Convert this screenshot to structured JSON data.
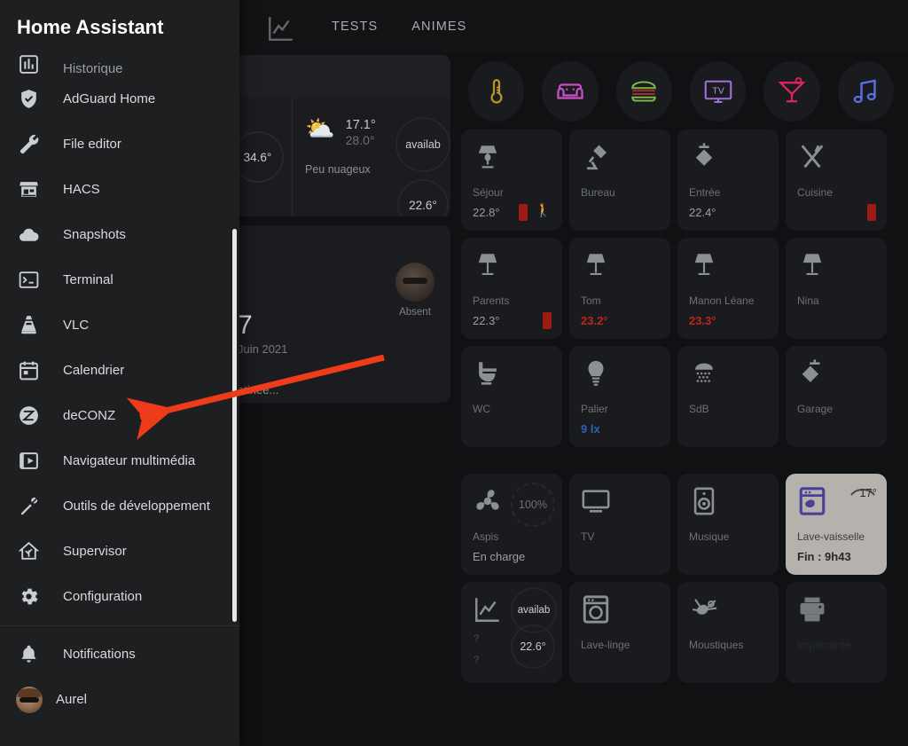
{
  "app": {
    "title": "Home Assistant"
  },
  "topbar": {
    "tabs": [
      {
        "label": "",
        "icon": "chart-line-icon"
      },
      {
        "label": "TESTS",
        "icon": ""
      },
      {
        "label": "ANIMES",
        "icon": ""
      }
    ]
  },
  "sidebar": {
    "title": "Home Assistant",
    "items": [
      {
        "label": "Historique",
        "icon": "chart-box-icon"
      },
      {
        "label": "AdGuard Home",
        "icon": "shield-check-icon"
      },
      {
        "label": "File editor",
        "icon": "wrench-icon"
      },
      {
        "label": "HACS",
        "icon": "store-icon"
      },
      {
        "label": "Snapshots",
        "icon": "cloud-icon"
      },
      {
        "label": "Terminal",
        "icon": "console-icon"
      },
      {
        "label": "VLC",
        "icon": "vlc-cone-icon"
      },
      {
        "label": "Calendrier",
        "icon": "calendar-icon"
      },
      {
        "label": "deCONZ",
        "icon": "zigbee-icon"
      },
      {
        "label": "Navigateur multimédia",
        "icon": "media-player-icon"
      },
      {
        "label": "Outils de développement",
        "icon": "hammer-wrench-icon"
      },
      {
        "label": "Supervisor",
        "icon": "home-assistant-icon"
      },
      {
        "label": "Configuration",
        "icon": "gear-icon"
      }
    ],
    "bottom": [
      {
        "label": "Notifications",
        "icon": "bell-icon"
      },
      {
        "label": "Aurel",
        "icon": "user-avatar"
      }
    ]
  },
  "weather": {
    "left_value": "34.6°",
    "icon": "partly-cloudy-icon",
    "temp_high": "17.1°",
    "temp_low": "28.0°",
    "condition": "Peu nuageux",
    "availability": "availab",
    "temp_right": "22.6°"
  },
  "person": {
    "state": "Absent",
    "big": "7",
    "date": "Juin 2021",
    "note": "atinée..."
  },
  "scenes": [
    {
      "name": "thermometer-scene",
      "icon": "thermometer-icon",
      "color": "#c9a227"
    },
    {
      "name": "living-room-scene",
      "icon": "sofa-icon",
      "color": "#d44fd4"
    },
    {
      "name": "burger-scene",
      "icon": "burger-icon",
      "color": "#7ab648"
    },
    {
      "name": "tv-scene",
      "icon": "tv-icon",
      "color": "#a06fd8"
    },
    {
      "name": "cocktail-scene",
      "icon": "cocktail-icon",
      "color": "#e0245e"
    },
    {
      "name": "music-scene",
      "icon": "music-note-icon",
      "color": "#5b6fe0"
    }
  ],
  "tiles": {
    "row1": [
      {
        "name": "Séjour",
        "value": "22.8°",
        "icon": "lamp-icon",
        "state": "off",
        "badges": [
          "battery",
          "motion"
        ]
      },
      {
        "name": "Bureau",
        "value": "",
        "icon": "desk-lamp-icon",
        "state": "off",
        "badges": []
      },
      {
        "name": "Entrée",
        "value": "22.4°",
        "icon": "ceiling-light-icon",
        "state": "off",
        "badges": []
      },
      {
        "name": "Cuisine",
        "value": "",
        "icon": "cutlery-icon",
        "state": "off",
        "badges": [
          "battery"
        ]
      }
    ],
    "row2": [
      {
        "name": "Parents",
        "value": "22.3°",
        "icon": "lamp-icon",
        "state": "off",
        "badges": [
          "battery"
        ]
      },
      {
        "name": "Tom",
        "value": "23.2°",
        "icon": "lamp-icon",
        "state": "off",
        "value_color": "red",
        "badges": []
      },
      {
        "name": "Manon Léane",
        "value": "23.3°",
        "icon": "lamp-icon",
        "state": "off",
        "value_color": "red",
        "badges": []
      },
      {
        "name": "Nina",
        "value": "",
        "icon": "lamp-icon",
        "state": "off",
        "badges": []
      }
    ],
    "row3": [
      {
        "name": "WC",
        "value": "",
        "icon": "toilet-icon",
        "state": "off",
        "badges": []
      },
      {
        "name": "Palier",
        "value": "9 lx",
        "icon": "bulb-icon",
        "state": "off",
        "value_color": "blue",
        "badges": []
      },
      {
        "name": "SdB",
        "value": "",
        "icon": "shower-icon",
        "state": "off",
        "badges": []
      },
      {
        "name": "Garage",
        "value": "",
        "icon": "ceiling-light-icon",
        "state": "off",
        "badges": []
      }
    ],
    "row4": [
      {
        "name": "Aspis",
        "value": "En charge",
        "icon": "vacuum-icon",
        "state": "off",
        "corner": "100%",
        "badges": []
      },
      {
        "name": "TV",
        "value": "",
        "icon": "television-icon",
        "state": "off",
        "badges": []
      },
      {
        "name": "Musique",
        "value": "",
        "icon": "speaker-icon",
        "state": "off",
        "badges": []
      },
      {
        "name": "Lave-vaisselle",
        "value": "Fin : 9h43",
        "icon": "dishwasher-icon",
        "state": "on",
        "corner": "17°",
        "badges": []
      }
    ],
    "row5": [
      {
        "name": "",
        "value": "",
        "icon": "chart-line-icon",
        "state": "off",
        "ring_top": "availab",
        "ring_bottom": "22.6°",
        "mini_a": "?",
        "mini_b": "?",
        "badges": []
      },
      {
        "name": "Lave-linge",
        "value": "",
        "icon": "washing-machine-icon",
        "state": "off",
        "badges": []
      },
      {
        "name": "Moustiques",
        "value": "",
        "icon": "mosquito-icon",
        "state": "off",
        "badges": []
      },
      {
        "name": "Imprimante",
        "value": "",
        "icon": "printer-icon",
        "state": "off",
        "badges": []
      }
    ]
  },
  "annotation": {
    "arrow_color": "#ee3b1a",
    "points_to": "deCONZ"
  }
}
